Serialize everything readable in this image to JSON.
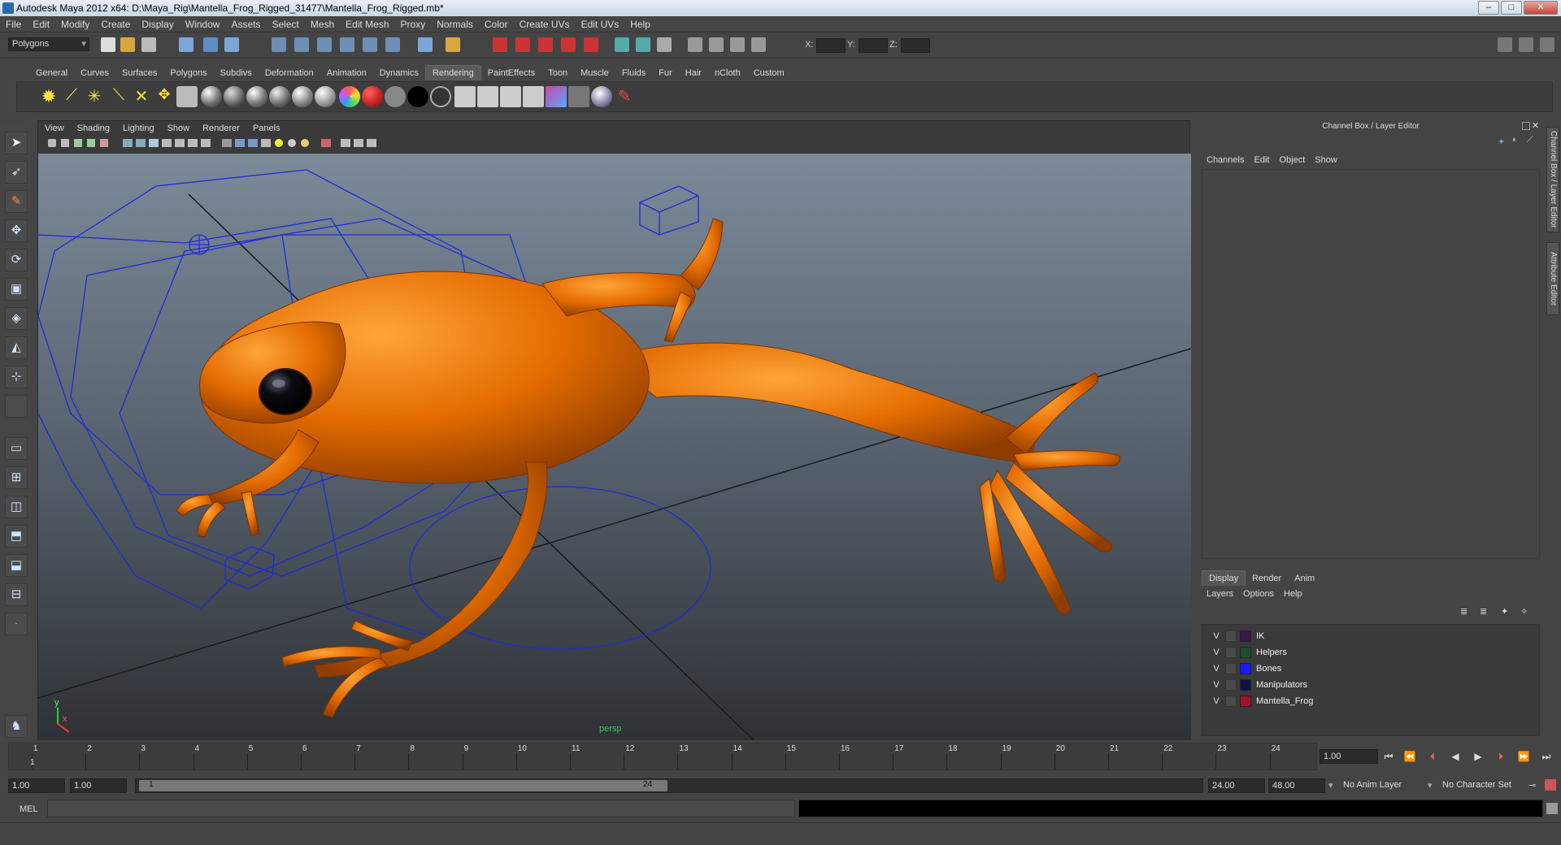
{
  "window": {
    "title": "Autodesk Maya 2012 x64: D:\\Maya_Rig\\Mantella_Frog_Rigged_31477\\Mantella_Frog_Rigged.mb*"
  },
  "menubar": {
    "items": [
      "File",
      "Edit",
      "Modify",
      "Create",
      "Display",
      "Window",
      "Assets",
      "Select",
      "Mesh",
      "Edit Mesh",
      "Proxy",
      "Normals",
      "Color",
      "Create UVs",
      "Edit UVs",
      "Help"
    ]
  },
  "statusline": {
    "menu_set": "Polygons",
    "x_label": "X:",
    "y_label": "Y:",
    "z_label": "Z:"
  },
  "shelf": {
    "tabs": [
      "General",
      "Curves",
      "Surfaces",
      "Polygons",
      "Subdivs",
      "Deformation",
      "Animation",
      "Dynamics",
      "Rendering",
      "PaintEffects",
      "Toon",
      "Muscle",
      "Fluids",
      "Fur",
      "Hair",
      "nCloth",
      "Custom"
    ],
    "active_tab": "Rendering"
  },
  "viewport": {
    "menus": [
      "View",
      "Shading",
      "Lighting",
      "Show",
      "Renderer",
      "Panels"
    ],
    "camera_label": "persp",
    "axis_y": "y",
    "axis_x": "x"
  },
  "channel_box": {
    "title": "Channel Box / Layer Editor",
    "menus": [
      "Channels",
      "Edit",
      "Object",
      "Show"
    ]
  },
  "side_tabs": [
    "Channel Box / Layer Editor",
    "Attribute Editor"
  ],
  "layer_editor": {
    "tabs": [
      "Display",
      "Render",
      "Anim"
    ],
    "active_tab": "Display",
    "menus": [
      "Layers",
      "Options",
      "Help"
    ],
    "layers": [
      {
        "visible": "V",
        "name": "IK",
        "color": "#3a1650"
      },
      {
        "visible": "V",
        "name": "Helpers",
        "color": "#1c4d2e"
      },
      {
        "visible": "V",
        "name": "Bones",
        "color": "#1a1aff"
      },
      {
        "visible": "V",
        "name": "Manipulators",
        "color": "#101048"
      },
      {
        "visible": "V",
        "name": "Mantella_Frog",
        "color": "#a0102a"
      }
    ]
  },
  "time_slider": {
    "ticks": [
      "1",
      "2",
      "3",
      "4",
      "5",
      "6",
      "7",
      "8",
      "9",
      "10",
      "11",
      "12",
      "13",
      "14",
      "15",
      "16",
      "17",
      "18",
      "19",
      "20",
      "21",
      "22",
      "23",
      "24"
    ],
    "current_frame_marker": "1",
    "current_time": "1.00"
  },
  "range": {
    "start_time": "1.00",
    "playback_start": "1.00",
    "slider_start": "1",
    "slider_end": "24",
    "playback_end": "24.00",
    "end_time": "48.00",
    "anim_layer": "No Anim Layer",
    "character_set": "No Character Set"
  },
  "command_line": {
    "label": "MEL"
  }
}
